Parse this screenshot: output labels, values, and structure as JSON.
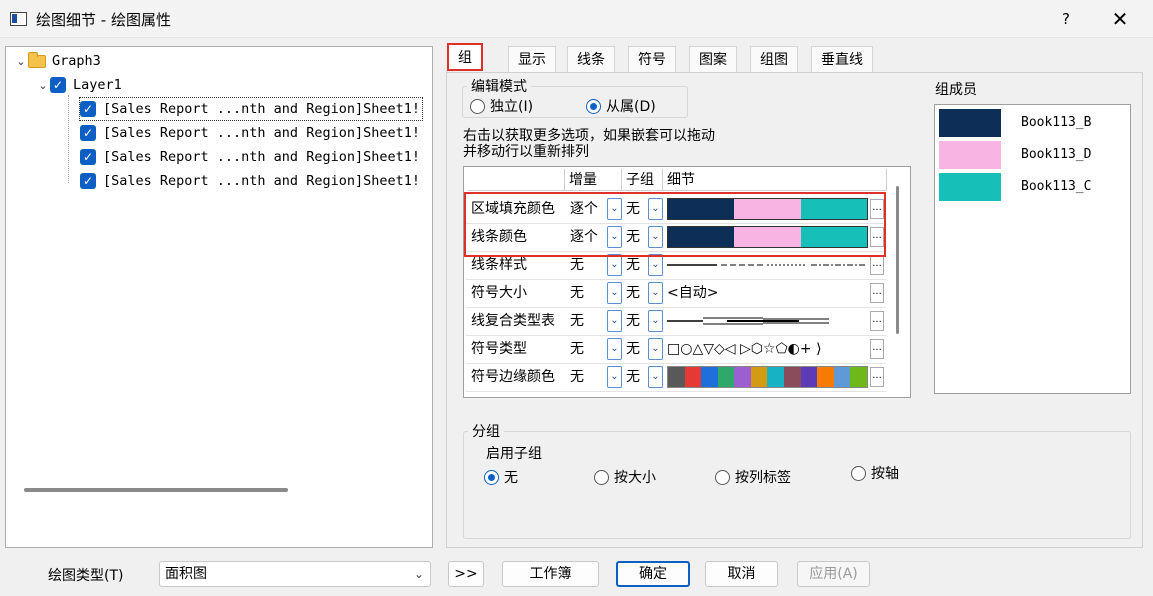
{
  "window": {
    "title": "绘图细节 - 绘图属性",
    "help": "?",
    "close": "✕"
  },
  "tree": {
    "root": "Graph3",
    "layer": "Layer1",
    "items": [
      "[Sales Report ...nth and Region]Sheet1!",
      "[Sales Report ...nth and Region]Sheet1!",
      "[Sales Report ...nth and Region]Sheet1!",
      "[Sales Report ...nth and Region]Sheet1!"
    ]
  },
  "tabs": [
    "组",
    "显示",
    "线条",
    "符号",
    "图案",
    "组图",
    "垂直线"
  ],
  "edit_mode": {
    "legend": "编辑模式",
    "independent": "独立(I)",
    "dependent": "从属(D)",
    "selected": "dependent"
  },
  "hint": {
    "line1": "右击以获取更多选项，如果嵌套可以拖动",
    "line2": "并移动行以重新排列"
  },
  "grid": {
    "headers": [
      "增量",
      "子组",
      "细节"
    ],
    "rows": [
      {
        "name": "区域填充颜色",
        "inc": "逐个",
        "sub": "无",
        "detail": "colors"
      },
      {
        "name": "线条颜色",
        "inc": "逐个",
        "sub": "无",
        "detail": "colors"
      },
      {
        "name": "线条样式",
        "inc": "无",
        "sub": "无",
        "detail": "linestyles"
      },
      {
        "name": "符号大小",
        "inc": "无",
        "sub": "无",
        "detail": "<自动>"
      },
      {
        "name": "线复合类型表",
        "inc": "无",
        "sub": "无",
        "detail": "compound"
      },
      {
        "name": "符号类型",
        "inc": "无",
        "sub": "无",
        "detail": "□○△▽◇◁ ▷⬡☆⬠◐+ ⟩"
      },
      {
        "name": "符号边缘颜色",
        "inc": "无",
        "sub": "无",
        "detail": "palette"
      }
    ],
    "group_colors": [
      "#0d2f57",
      "#f8b4e3",
      "#16c0b8"
    ],
    "palette": [
      "#595959",
      "#e53935",
      "#1e6fd9",
      "#2fa86a",
      "#9b5fd1",
      "#d29b12",
      "#17b3c4",
      "#8a4b5a",
      "#5b3bb8",
      "#f57c00",
      "#5e9bd6",
      "#6fb81a"
    ]
  },
  "members": {
    "label": "组成员",
    "items": [
      {
        "name": "Book113_B",
        "color": "#0d2f57"
      },
      {
        "name": "Book113_D",
        "color": "#f8b4e3"
      },
      {
        "name": "Book113_C",
        "color": "#16c0b8"
      }
    ]
  },
  "grouping": {
    "legend": "分组",
    "enable": "启用子组",
    "options": [
      "无",
      "按大小",
      "按列标签",
      "按轴"
    ],
    "selected": 0
  },
  "bottom": {
    "plot_type_label": "绘图类型(T)",
    "plot_type_value": "面积图",
    "expand": ">>",
    "workbook": "工作簿",
    "ok": "确定",
    "cancel": "取消",
    "apply": "应用(A)"
  }
}
